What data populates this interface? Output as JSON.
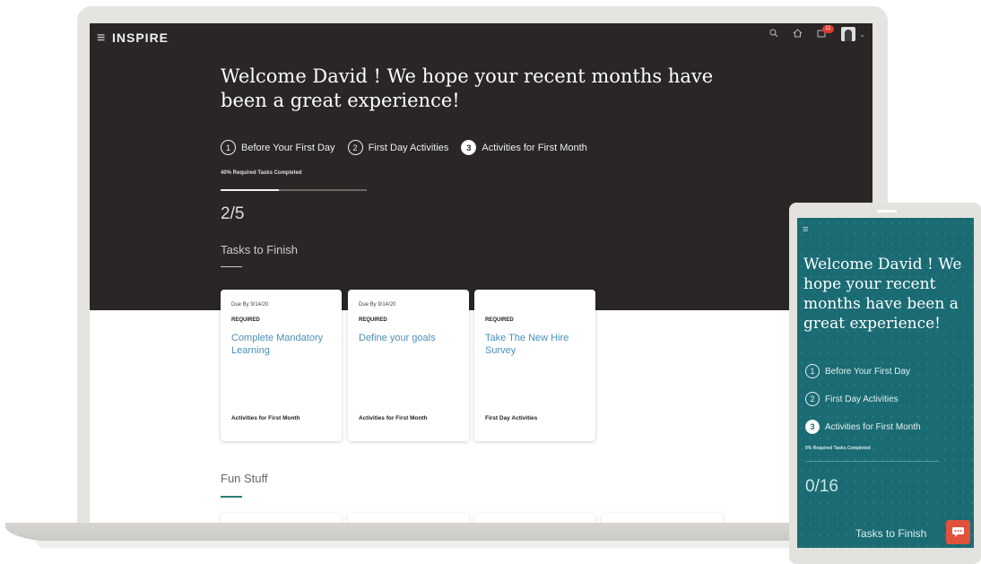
{
  "app": {
    "logo": "INSPIRE"
  },
  "header": {
    "notification_count": "11"
  },
  "hero": {
    "welcome": "Welcome David ! We hope your recent months have been a great experience!",
    "steps": [
      {
        "number": "1",
        "label": "Before Your First Day",
        "active": false
      },
      {
        "number": "2",
        "label": "First Day Activities",
        "active": false
      },
      {
        "number": "3",
        "label": "Activities for First Month",
        "active": true
      }
    ],
    "required_text": "40% Required Tasks Completed",
    "progress_percent": 40,
    "count": "2/5",
    "tasks_title": "Tasks to Finish"
  },
  "cards": [
    {
      "due": "Due By 9/14/20",
      "req": "REQUIRED",
      "title": "Complete Mandatory Learning",
      "footer": "Activities for First Month"
    },
    {
      "due": "Due By 9/14/20",
      "req": "REQUIRED",
      "title": "Define your goals",
      "footer": "Activities for First Month"
    },
    {
      "due": "",
      "req": "REQUIRED",
      "title": "Take The New Hire Survey",
      "footer": "First Day Activities"
    }
  ],
  "fun": {
    "title": "Fun Stuff"
  },
  "phone": {
    "welcome": "Welcome David ! We hope your recent months have been a great experience!",
    "steps": [
      {
        "number": "1",
        "label": "Before Your First Day"
      },
      {
        "number": "2",
        "label": "First Day Activities"
      },
      {
        "number": "3",
        "label": "Activities for First Month"
      }
    ],
    "required_text": "0% Required Tasks Completed",
    "progress_percent": 0,
    "count": "0/16",
    "tasks_title": "Tasks to Finish"
  },
  "icons": {
    "menu": "≡",
    "search": "⚲",
    "home": "⌂",
    "notifications": "☐",
    "caret": "⌄",
    "chat": "…"
  },
  "colors": {
    "hero_bg": "#292625",
    "link": "#4a90b8",
    "accent": "#2a7d74",
    "phone_bg": "#1a6b73",
    "chat": "#e0523c"
  }
}
